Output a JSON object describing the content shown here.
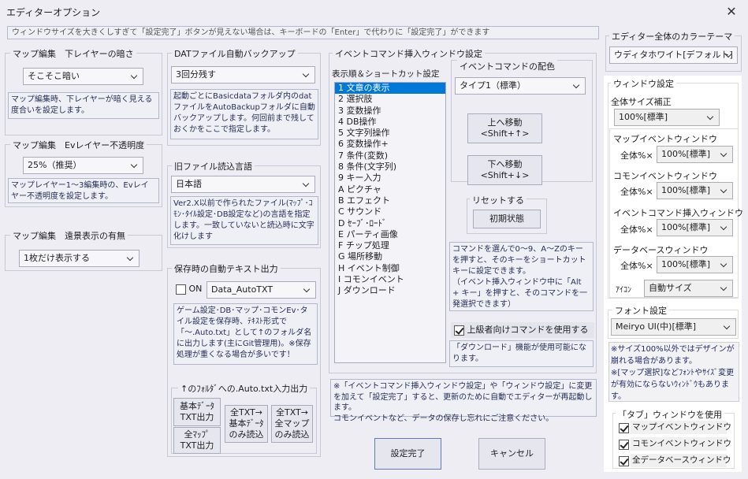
{
  "window": {
    "title": "エディターオプション",
    "close_glyph": "✕"
  },
  "banner": "ウィンドウサイズを大きくしすぎて「設定完了」ボタンが見えない場合は、キーボードの「Enter」で代わりに「設定完了」ができます",
  "map_lower_layer": {
    "label": "マップ編集　下レイヤーの暗さ",
    "value": "そこそこ暗い",
    "note": "マップ編集時、下レイヤーが暗く見える度合いを設定します。"
  },
  "map_ev_opacity": {
    "label": "マップ編集　Evレイヤー不透明度",
    "value": "25%（推奨）",
    "note": "マップレイヤー1～3編集時の、Evレイヤー不透明度を設定します。"
  },
  "map_distant": {
    "label": "マップ編集　遠景表示の有無",
    "value": "1枚だけ表示する"
  },
  "dat_backup": {
    "label": "DATファイル自動バックアップ",
    "value": "3回分残す",
    "note": "起動ごとにBasicdataフォルダ内のdatファイルをAutoBackupフォルダに自動バックアップします。何回前まで残しておくかをここで指定します。"
  },
  "old_file_lang": {
    "label": "旧ファイル読込言語",
    "value": "日本語",
    "note": "Ver2.X以前で作られたファイル(ﾏｯﾌﾟ･ｺﾓﾝ･ﾀｲﾙ設定･DB設定など)の言語を指定します。一致していないと読込時に文字化けします"
  },
  "auto_text": {
    "label": "保存時の自動テキスト出力",
    "on_label": "ON",
    "value": "Data_AutoTXT",
    "note": "ゲーム設定･DB･マップ･コモンEv･タイル設定を保存時、ﾃｷｽﾄ形式で「～.Auto.txt」として↑のフォルダ名に出力します(主にGit管理用)。※保存処理が重くなる場合が多いです！",
    "subgroup_label": "↑のﾌｫﾙﾀﾞへの.Auto.txt入力出力",
    "btn_basic_data": [
      "基本ﾃﾞｰﾀ",
      "TXT出力"
    ],
    "btn_all_map": [
      "全ﾏｯﾌﾟ",
      "TXT出力"
    ],
    "btn_all_txt_basic": [
      "全TXT→",
      "基本ﾃﾞｰﾀ",
      "のみ読込"
    ],
    "btn_all_txt_map": [
      "全TXT→",
      "全マップ",
      "のみ読込"
    ]
  },
  "event_cmd": {
    "label": "イベントコマンド挿入ウィンドウ設定",
    "order_label": "表示順＆ショートカット設定",
    "items": [
      "1 文章の表示",
      "2 選択肢",
      "3 変数操作",
      "4 DB操作",
      "5 文字列操作",
      "6 変数操作+",
      "7 条件(変数)",
      "8 条件(文字列)",
      "9 キー入力",
      "A ピクチャ",
      "B エフェクト",
      "C サウンド",
      "D ｾｰﾌﾞ･ﾛｰﾄﾞ",
      "E パーティ画像",
      "F チップ処理",
      "G 場所移動",
      "H イベント制御",
      "I コモンイベント",
      "J ダウンロード"
    ],
    "color_label": "イベントコマンドの配色",
    "color_value": "タイプ1（標準）",
    "move_up": [
      "上へ移動",
      "<Shift+↑>"
    ],
    "move_down": [
      "下へ移動",
      "<Shift+↓>"
    ],
    "reset_label": "リセットする",
    "reset_button": "初期状態",
    "shortcut_note": "コマンドを選んで0～9、A～Zのキーを押すと、そのキーをショートカットキーに設定できます。\n（イベント挿入ウィンドウ中に「Alt + キー」を押すと、そのコマンドを一発選択できます）",
    "advanced_label": "上級者向けコマンドを使用する",
    "advanced_note": "「ダウンロード」機能が使用可能になります。"
  },
  "restart_note": "※「イベントコマンド挿入ウィンドウ設定」や「ウィンドウ設定」に変更を加えて「設定完了」すると、更新のために自動でエディターが再起動します。\nコモンイベントなど、データの保存し忘れにご注意ください。",
  "buttons": {
    "ok": "設定完了",
    "cancel": "キャンセル"
  },
  "theme": {
    "label": "エディター全体のカラーテーマ",
    "value": "ウディタホワイト[デフォルト]"
  },
  "window_settings": {
    "label": "ウィンドウ設定",
    "overall_label": "全体サイズ補正",
    "overall_value": "100%[標準]",
    "map_event": {
      "label": "マップイベントウィンドウ",
      "prefix": "全体%×",
      "value": "100%[標準]"
    },
    "common_event": {
      "label": "コモンイベントウィンドウ",
      "prefix": "全体%×",
      "value": "100%[標準]"
    },
    "event_cmd": {
      "label": "イベントコマンド挿入ウィンドウ",
      "prefix": "全体%×",
      "value": "100%[標準]"
    },
    "database": {
      "label": "データベースウィンドウ",
      "prefix": "全体%×",
      "value": "100%[標準]"
    },
    "icon": {
      "label": "ｱｲｺﾝ",
      "value": "自動サイズ"
    }
  },
  "font": {
    "label": "フォント設定",
    "value": "Meiryo UI(中)[標準]"
  },
  "font_note": "※サイズ100%以外ではデザインが崩れる場合があります。\n※[マップ選択]などﾌｫﾝﾄやｻｲｽﾞ変更が有効にならないｳｨﾝﾄﾞｳもあります。",
  "tabs": {
    "label": "「タブ」ウィンドウを使用",
    "items": [
      "マップイベントウィンドウ",
      "コモンイベントウィンドウ",
      "全データベースウィンドウ"
    ]
  },
  "colors": {
    "dim_bg": "#ededf3",
    "note_text": "#282e56",
    "selection": "#0078d7"
  }
}
